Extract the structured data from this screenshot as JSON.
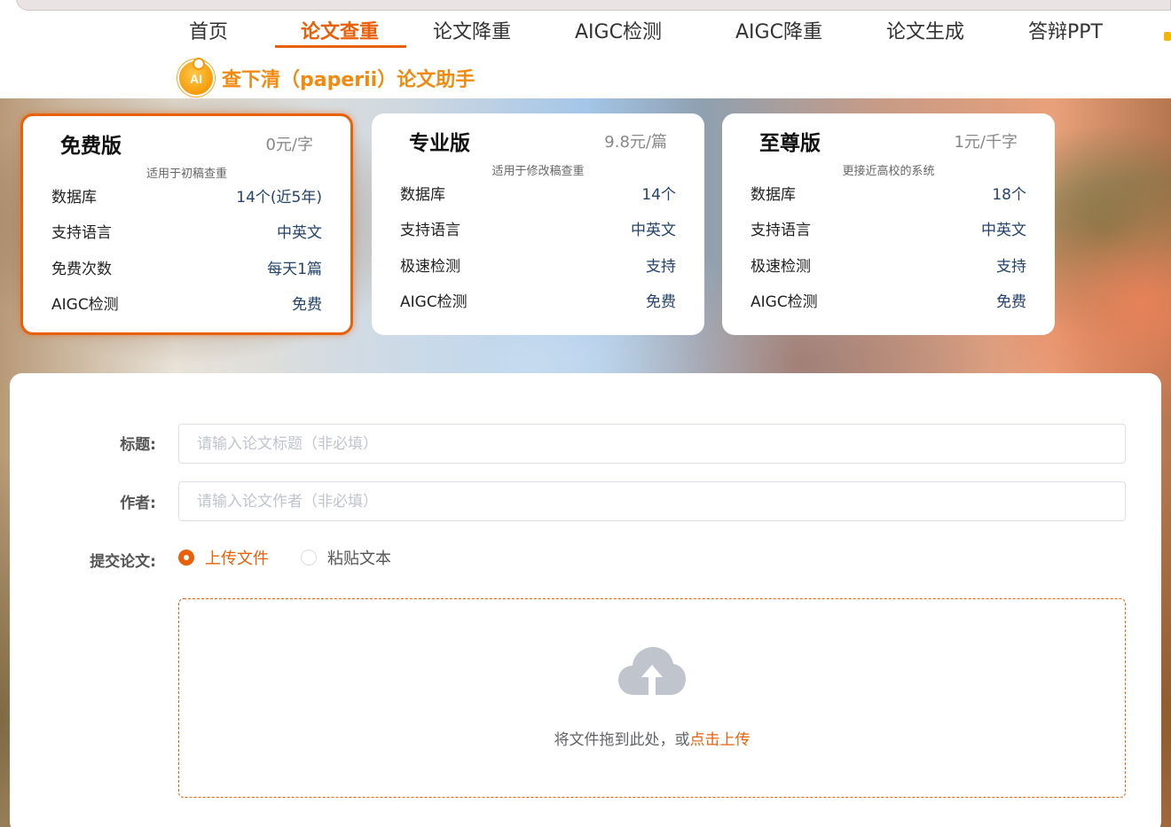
{
  "nav": {
    "items": [
      {
        "label": "首页"
      },
      {
        "label": "论文查重"
      },
      {
        "label": "论文降重"
      },
      {
        "label": "AIGC检测"
      },
      {
        "label": "AIGC降重"
      },
      {
        "label": "论文生成"
      },
      {
        "label": "答辩PPT"
      }
    ],
    "active": "论文查重"
  },
  "brand": {
    "logo_text": "AI",
    "name": "查下清（paperii）论文助手"
  },
  "plans": [
    {
      "name": "免费版",
      "price": "0元/字",
      "subtitle": "适用于初稿查重",
      "selected": true,
      "rows": [
        {
          "key": "数据库",
          "value": "14个(近5年)"
        },
        {
          "key": "支持语言",
          "value": "中英文"
        },
        {
          "key": "免费次数",
          "value": "每天1篇"
        },
        {
          "key": "AIGC检测",
          "value": "免费"
        }
      ]
    },
    {
      "name": "专业版",
      "price": "9.8元/篇",
      "subtitle": "适用于修改稿查重",
      "selected": false,
      "rows": [
        {
          "key": "数据库",
          "value": "14个"
        },
        {
          "key": "支持语言",
          "value": "中英文"
        },
        {
          "key": "极速检测",
          "value": "支持"
        },
        {
          "key": "AIGC检测",
          "value": "免费"
        }
      ]
    },
    {
      "name": "至尊版",
      "price": "1元/千字",
      "subtitle": "更接近高校的系统",
      "selected": false,
      "rows": [
        {
          "key": "数据库",
          "value": "18个"
        },
        {
          "key": "支持语言",
          "value": "中英文"
        },
        {
          "key": "极速检测",
          "value": "支持"
        },
        {
          "key": "AIGC检测",
          "value": "免费"
        }
      ]
    }
  ],
  "form": {
    "title_label": "标题:",
    "title_placeholder": "请输入论文标题（非必填）",
    "title_value": "",
    "author_label": "作者:",
    "author_placeholder": "请输入论文作者（非必填）",
    "author_value": "",
    "submit_label": "提交论文:",
    "radio_upload": "上传文件",
    "radio_paste": "粘贴文本",
    "selected_mode": "上传文件"
  },
  "upload": {
    "icon": "cloud-upload-icon",
    "text": "将文件拖到此处，或",
    "link": "点击上传"
  },
  "colors": {
    "accent": "#e8600a",
    "brand": "#f08a10",
    "value_text": "#24436b"
  }
}
